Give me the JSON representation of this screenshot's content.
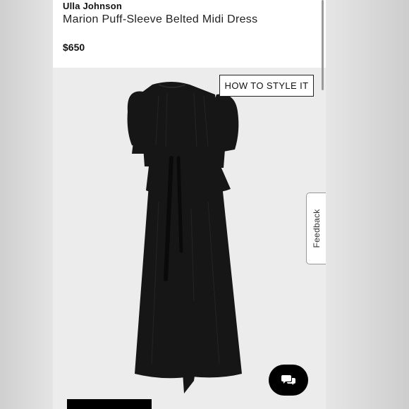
{
  "product": {
    "brand": "Ulla Johnson",
    "name": "Marion Puff-Sleeve Belted Midi Dress",
    "price": "$650"
  },
  "actions": {
    "style_label": "HOW TO STYLE IT",
    "feedback_label": "Feedback"
  },
  "icons": {
    "chat": "chat-bubbles-icon"
  },
  "colors": {
    "dress": "#161616",
    "background": "#ececec",
    "chat_button": "#000000"
  }
}
